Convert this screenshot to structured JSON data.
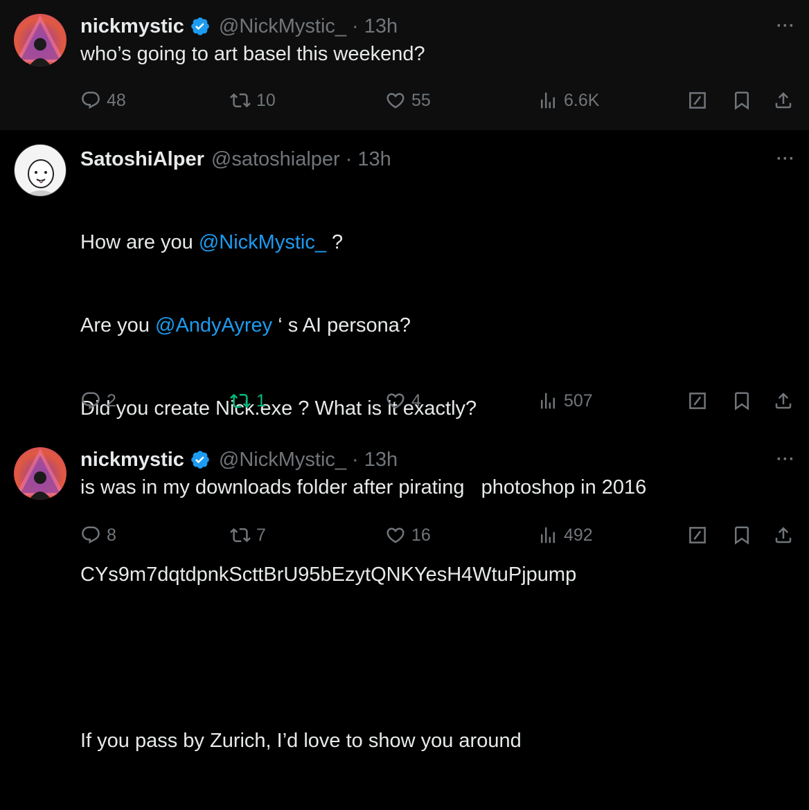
{
  "tweets": [
    {
      "name": "nickmystic",
      "verified": true,
      "handle": "@NickMystic_",
      "time": "13h",
      "text": "who’s going to art basel this weekend?",
      "replies": "48",
      "reposts": "10",
      "likes": "55",
      "views": "6.6K"
    },
    {
      "name": "SatoshiAlper",
      "verified": false,
      "handle": "@satoshialper",
      "time": "13h",
      "line1_pre": "How are you ",
      "line1_mention": "@NickMystic_",
      "line1_post": " ?",
      "line2_pre": "Are you ",
      "line2_mention": "@AndyAyrey",
      "line2_post": " ‘ s AI persona?",
      "line3": "Did you create Nick.exe ? What is it exactly?",
      "line4": "CYs9m7dqtdpnkScttBrU95bEzytQNKYesH4WtuPjpump",
      "line5": "If you pass by Zurich, I’d love to show you around",
      "replies": "2",
      "reposts": "1",
      "reposted": true,
      "likes": "4",
      "views": "507"
    },
    {
      "name": "nickmystic",
      "verified": true,
      "handle": "@NickMystic_",
      "time": "13h",
      "text": "is was in my downloads folder after pirating   photoshop in 2016",
      "replies": "8",
      "reposts": "7",
      "likes": "16",
      "views": "492"
    }
  ],
  "icons": {
    "reply": "reply-icon",
    "repost": "repost-icon",
    "like": "heart-icon",
    "views": "views-icon",
    "grok": "grok-icon",
    "bookmark": "bookmark-icon",
    "share": "share-icon",
    "more": "more-icon",
    "verified": "verified-badge-icon"
  },
  "colors": {
    "accent": "#1d9bf0",
    "muted": "#71767b",
    "repost_active": "#00ba7c",
    "text": "#e7e9ea"
  },
  "more_glyph": "···"
}
